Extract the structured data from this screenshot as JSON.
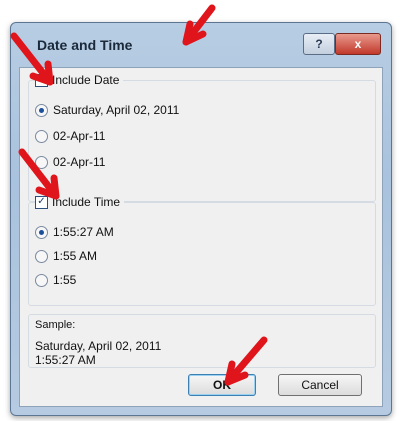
{
  "dialog": {
    "title": "Date and Time",
    "help_label": "?",
    "close_label": "x"
  },
  "date_group": {
    "checkbox_label": "Include Date",
    "checked": true,
    "options": [
      {
        "label": "Saturday, April 02, 2011",
        "selected": true
      },
      {
        "label": "02-Apr-11",
        "selected": false
      },
      {
        "label": "02-Apr-11",
        "selected": false
      }
    ]
  },
  "time_group": {
    "checkbox_label": "Include Time",
    "checked": true,
    "options": [
      {
        "label": "1:55:27 AM",
        "selected": true
      },
      {
        "label": "1:55 AM",
        "selected": false
      },
      {
        "label": "1:55",
        "selected": false
      }
    ]
  },
  "sample": {
    "label": "Sample:",
    "line1": "Saturday, April 02, 2011",
    "line2": "1:55:27 AM"
  },
  "buttons": {
    "ok_label": "OK",
    "cancel_label": "Cancel"
  },
  "colors": {
    "annotation_arrow": "#e0141b"
  }
}
